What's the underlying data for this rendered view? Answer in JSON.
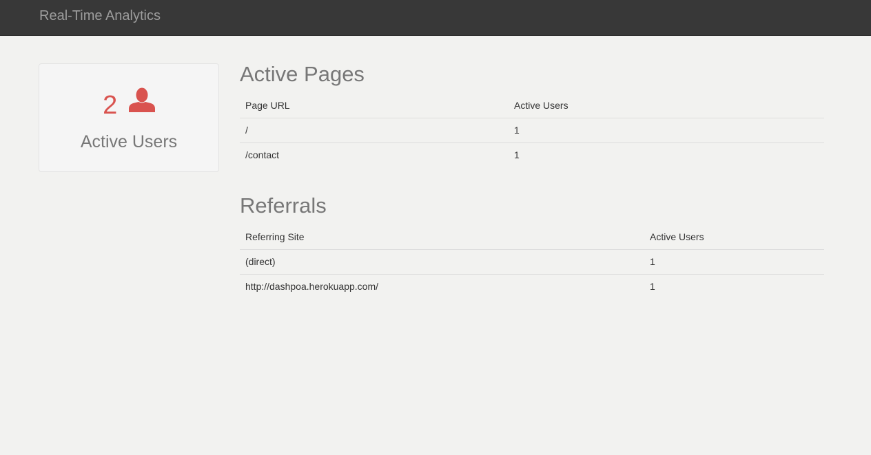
{
  "navbar": {
    "brand": "Real-Time Analytics"
  },
  "active_users_panel": {
    "count": "2",
    "icon": "user-icon",
    "label": "Active Users"
  },
  "active_pages": {
    "title": "Active Pages",
    "columns": [
      "Page URL",
      "Active Users"
    ],
    "rows": [
      [
        "/",
        "1"
      ],
      [
        "/contact",
        "1"
      ]
    ]
  },
  "referrals": {
    "title": "Referrals",
    "columns": [
      "Referring Site",
      "Active Users"
    ],
    "rows": [
      [
        "(direct)",
        "1"
      ],
      [
        "http://dashpoa.herokuapp.com/",
        "1"
      ]
    ]
  },
  "colors": {
    "navbar_bg": "#383838",
    "accent_red": "#d9534f",
    "page_bg": "#f2f2f0"
  }
}
